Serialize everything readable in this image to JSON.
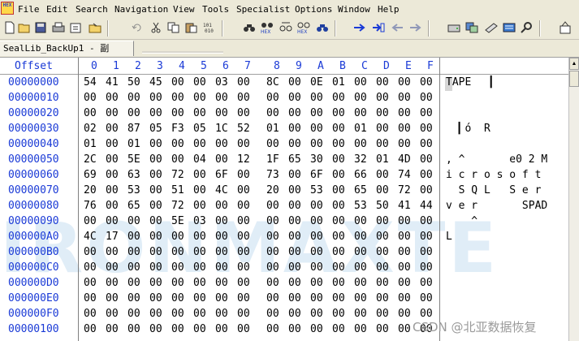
{
  "app": {
    "icon_text": "HEX",
    "menu": [
      "File",
      "Edit",
      "Search",
      "Navigation",
      "View",
      "Tools",
      "Specialist",
      "Options",
      "Window",
      "Help"
    ]
  },
  "toolbar": {
    "buttons": [
      "new-icon",
      "open-icon",
      "save-icon",
      "print-icon",
      "properties-icon",
      "open-disk-icon",
      "undo-icon",
      "cut-icon",
      "copy-icon",
      "paste-icon",
      "paste-write-icon",
      "binary-icon",
      "find-icon",
      "find-hex-icon",
      "replace-icon",
      "replace-hex-icon",
      "find-next-icon",
      "goto-offset-icon",
      "goto-sector-icon",
      "back-icon",
      "forward-icon",
      "disk-icon",
      "data-interpreter-icon",
      "ram-icon",
      "calculator-icon",
      "search-icon",
      "cleanup-icon"
    ]
  },
  "tab": {
    "label": "SealLib_BackUp1 - 副本.dat"
  },
  "header": {
    "offset_label": "Offset",
    "columns": [
      "0",
      "1",
      "2",
      "3",
      "4",
      "5",
      "6",
      "7",
      "8",
      "9",
      "A",
      "B",
      "C",
      "D",
      "E",
      "F"
    ]
  },
  "rows": [
    {
      "offset": "00000000",
      "bytes": [
        "54",
        "41",
        "50",
        "45",
        "00",
        "00",
        "03",
        "00",
        "8C",
        "00",
        "0E",
        "01",
        "00",
        "00",
        "00",
        "00"
      ],
      "ascii": "TAPE   ▎"
    },
    {
      "offset": "00000010",
      "bytes": [
        "00",
        "00",
        "00",
        "00",
        "00",
        "00",
        "00",
        "00",
        "00",
        "00",
        "00",
        "00",
        "00",
        "00",
        "00",
        "00"
      ],
      "ascii": ""
    },
    {
      "offset": "00000020",
      "bytes": [
        "00",
        "00",
        "00",
        "00",
        "00",
        "00",
        "00",
        "00",
        "00",
        "00",
        "00",
        "00",
        "00",
        "00",
        "00",
        "00"
      ],
      "ascii": ""
    },
    {
      "offset": "00000030",
      "bytes": [
        "02",
        "00",
        "87",
        "05",
        "F3",
        "05",
        "1C",
        "52",
        "01",
        "00",
        "00",
        "00",
        "01",
        "00",
        "00",
        "00"
      ],
      "ascii": "  ▎ó  R"
    },
    {
      "offset": "00000040",
      "bytes": [
        "01",
        "00",
        "01",
        "00",
        "00",
        "00",
        "00",
        "00",
        "00",
        "00",
        "00",
        "00",
        "00",
        "00",
        "00",
        "00"
      ],
      "ascii": ""
    },
    {
      "offset": "00000050",
      "bytes": [
        "2C",
        "00",
        "5E",
        "00",
        "00",
        "04",
        "00",
        "12",
        "1F",
        "65",
        "30",
        "00",
        "32",
        "01",
        "4D",
        "00"
      ],
      "ascii": ", ^       e0 2 M"
    },
    {
      "offset": "00000060",
      "bytes": [
        "69",
        "00",
        "63",
        "00",
        "72",
        "00",
        "6F",
        "00",
        "73",
        "00",
        "6F",
        "00",
        "66",
        "00",
        "74",
        "00"
      ],
      "ascii": "i c r o s o f t"
    },
    {
      "offset": "00000070",
      "bytes": [
        "20",
        "00",
        "53",
        "00",
        "51",
        "00",
        "4C",
        "00",
        "20",
        "00",
        "53",
        "00",
        "65",
        "00",
        "72",
        "00"
      ],
      "ascii": "  S Q L   S e r"
    },
    {
      "offset": "00000080",
      "bytes": [
        "76",
        "00",
        "65",
        "00",
        "72",
        "00",
        "00",
        "00",
        "00",
        "00",
        "00",
        "00",
        "53",
        "50",
        "41",
        "44"
      ],
      "ascii": "v e r       SPAD"
    },
    {
      "offset": "00000090",
      "bytes": [
        "00",
        "00",
        "00",
        "00",
        "5E",
        "03",
        "00",
        "00",
        "00",
        "00",
        "00",
        "00",
        "00",
        "00",
        "00",
        "00"
      ],
      "ascii": "    ^"
    },
    {
      "offset": "000000A0",
      "bytes": [
        "4C",
        "17",
        "00",
        "00",
        "00",
        "00",
        "00",
        "00",
        "00",
        "00",
        "00",
        "00",
        "00",
        "00",
        "00",
        "00"
      ],
      "ascii": "L"
    },
    {
      "offset": "000000B0",
      "bytes": [
        "00",
        "00",
        "00",
        "00",
        "00",
        "00",
        "00",
        "00",
        "00",
        "00",
        "00",
        "00",
        "00",
        "00",
        "00",
        "00"
      ],
      "ascii": ""
    },
    {
      "offset": "000000C0",
      "bytes": [
        "00",
        "00",
        "00",
        "00",
        "00",
        "00",
        "00",
        "00",
        "00",
        "00",
        "00",
        "00",
        "00",
        "00",
        "00",
        "00"
      ],
      "ascii": ""
    },
    {
      "offset": "000000D0",
      "bytes": [
        "00",
        "00",
        "00",
        "00",
        "00",
        "00",
        "00",
        "00",
        "00",
        "00",
        "00",
        "00",
        "00",
        "00",
        "00",
        "00"
      ],
      "ascii": ""
    },
    {
      "offset": "000000E0",
      "bytes": [
        "00",
        "00",
        "00",
        "00",
        "00",
        "00",
        "00",
        "00",
        "00",
        "00",
        "00",
        "00",
        "00",
        "00",
        "00",
        "00"
      ],
      "ascii": ""
    },
    {
      "offset": "000000F0",
      "bytes": [
        "00",
        "00",
        "00",
        "00",
        "00",
        "00",
        "00",
        "00",
        "00",
        "00",
        "00",
        "00",
        "00",
        "00",
        "00",
        "00"
      ],
      "ascii": ""
    },
    {
      "offset": "00000100",
      "bytes": [
        "00",
        "00",
        "00",
        "00",
        "00",
        "00",
        "00",
        "00",
        "00",
        "00",
        "00",
        "00",
        "00",
        "00",
        "00",
        "00"
      ],
      "ascii": ""
    }
  ],
  "watermark": "IRONMAXTE",
  "credit": "CSDN @北亚数据恢复",
  "colors": {
    "offset_blue": "#1a3ad6",
    "chrome": "#ece9d8"
  }
}
